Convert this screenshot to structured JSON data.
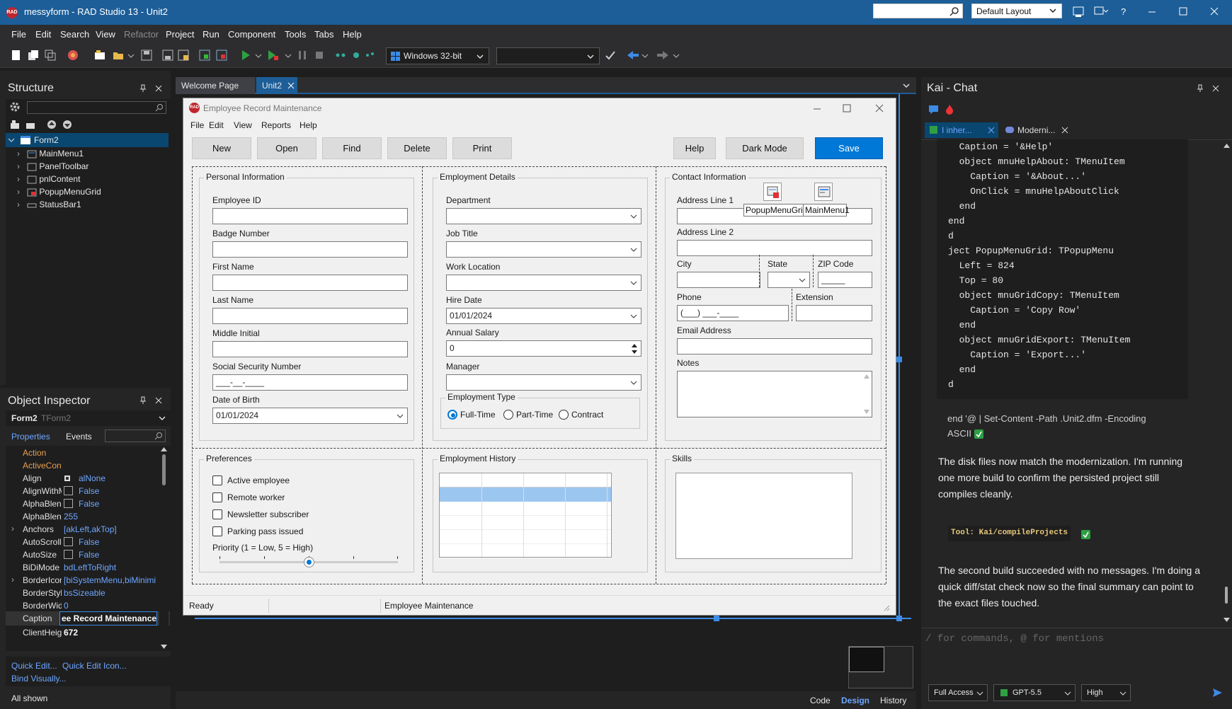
{
  "app": {
    "title": "messyform - RAD Studio 13 - Unit2",
    "logo_text": "RAD",
    "layout": "Default Layout",
    "help": "?"
  },
  "menu": [
    "File",
    "Edit",
    "Search",
    "View",
    "Refactor",
    "Project",
    "Run",
    "Component",
    "Tools",
    "Tabs",
    "Help"
  ],
  "toolbar": {
    "platform": "Windows 32-bit",
    "config": ""
  },
  "structure": {
    "title": "Structure",
    "root": "Form2",
    "items": [
      "MainMenu1",
      "PanelToolbar",
      "pnlContent",
      "PopupMenuGrid",
      "StatusBar1"
    ]
  },
  "inspector": {
    "title": "Object Inspector",
    "object": "Form2",
    "object_type": "TForm2",
    "tabs": [
      "Properties",
      "Events"
    ],
    "rows": [
      {
        "name": "Action",
        "value": ""
      },
      {
        "name": "ActiveControl",
        "value": ""
      },
      {
        "name": "Align",
        "value": "alNone"
      },
      {
        "name": "AlignWithMargins",
        "value": "False"
      },
      {
        "name": "AlphaBlend",
        "value": "False"
      },
      {
        "name": "AlphaBlendValue",
        "value": "255"
      },
      {
        "name": "Anchors",
        "value": "[akLeft,akTop]"
      },
      {
        "name": "AutoScroll",
        "value": "False"
      },
      {
        "name": "AutoSize",
        "value": "False"
      },
      {
        "name": "BiDiMode",
        "value": "bdLeftToRight"
      },
      {
        "name": "BorderIcons",
        "value": "[biSystemMenu,biMinimi"
      },
      {
        "name": "BorderStyle",
        "value": "bsSizeable"
      },
      {
        "name": "BorderWidth",
        "value": "0"
      },
      {
        "name": "Caption",
        "value": "ee Record Maintenance"
      },
      {
        "name": "ClientHeight",
        "value": "672"
      }
    ],
    "links": [
      "Quick Edit...",
      "Quick Edit Icon...",
      "Bind Visually..."
    ],
    "footer": "All shown"
  },
  "editor_tabs": [
    "Welcome Page",
    "Unit2"
  ],
  "form": {
    "title": "Employee Record Maintenance",
    "menu": [
      "File",
      "Edit",
      "View",
      "Reports",
      "Help"
    ],
    "buttons": [
      "New",
      "Open",
      "Find",
      "Delete",
      "Print",
      "Help",
      "Dark Mode",
      "Save"
    ],
    "personal": {
      "title": "Personal Information",
      "fields": [
        "Employee ID",
        "Badge Number",
        "First Name",
        "Last Name",
        "Middle Initial",
        "Social Security Number",
        "Date of Birth"
      ],
      "ssn_mask": "___-__-____",
      "dob": "01/01/2024"
    },
    "employment": {
      "title": "Employment Details",
      "fields": [
        "Department",
        "Job Title",
        "Work Location",
        "Hire Date",
        "Annual Salary",
        "Manager"
      ],
      "hire_date": "01/01/2024",
      "salary": "0",
      "type_title": "Employment Type",
      "types": [
        "Full-Time",
        "Part-Time",
        "Contract"
      ]
    },
    "contact": {
      "title": "Contact Information",
      "address1": "Address Line 1",
      "address2": "Address Line 2",
      "city": "City",
      "state": "State",
      "zip": "ZIP Code",
      "zip_mask": "_____",
      "phone": "Phone",
      "phone_mask": "(___) ___-____",
      "extension": "Extension",
      "email": "Email Address",
      "notes": "Notes",
      "comp_popup": "PopupMenuGrid",
      "comp_menu": "MainMenu1"
    },
    "preferences": {
      "title": "Preferences",
      "checks": [
        "Active employee",
        "Remote worker",
        "Newsletter subscriber",
        "Parking pass issued"
      ],
      "priority_label": "Priority (1 = Low, 5 = High)",
      "priority": 3
    },
    "history_title": "Employment History",
    "skills_title": "Skills",
    "status": [
      "Ready",
      "",
      "Employee Maintenance"
    ]
  },
  "bottom_tabs": [
    "Code",
    "Design",
    "History"
  ],
  "chat": {
    "title": "Kai - Chat",
    "tabs": [
      "I inher...",
      "Moderni..."
    ],
    "code": [
      "  Caption = '&Help'",
      "  object mnuHelpAbout: TMenuItem",
      "    Caption = '&About...'",
      "    OnClick = mnuHelpAboutClick",
      "  end",
      "end",
      "d",
      "ject PopupMenuGrid: TPopupMenu",
      "  Left = 824",
      "  Top = 80",
      "  object mnuGridCopy: TMenuItem",
      "    Caption = 'Copy Row'",
      "  end",
      "  object mnuGridExport: TMenuItem",
      "    Caption = 'Export...'",
      "  end",
      "d"
    ],
    "cmd_line1": "end '@ | Set-Content -Path .Unit2.dfm -Encoding",
    "cmd_line2": "ASCII",
    "msg1": "The disk files now match the modernization. I'm running one more build to confirm the persisted project still compiles cleanly.",
    "tool": "Tool: Kai/compileProjects",
    "msg2": "The second build succeeded with no messages. I'm doing a quick diff/stat check now so the final summary can point to the exact files touched.",
    "input_placeholder": "/ for commands, @ for mentions",
    "access": "Full Access",
    "model": "GPT-5.5",
    "effort": "High"
  },
  "colors": {
    "titlebar": "#1d5e98",
    "accent": "#0078d7",
    "panel": "#252526",
    "selected": "#094771"
  }
}
